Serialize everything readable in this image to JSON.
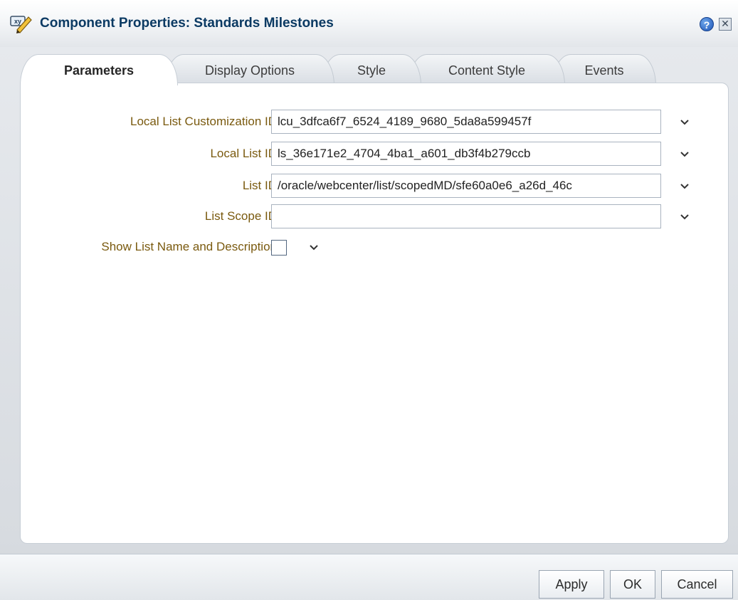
{
  "dialog": {
    "title": "Component Properties: Standards Milestones",
    "title_icon": "xy-component-icon",
    "help_icon": "help-icon",
    "help_glyph": "?",
    "close_icon": "close-icon",
    "close_glyph": "✕"
  },
  "tabs": [
    {
      "label": "Parameters",
      "active": true
    },
    {
      "label": "Display Options",
      "active": false
    },
    {
      "label": "Style",
      "active": false
    },
    {
      "label": "Content Style",
      "active": false
    },
    {
      "label": "Events",
      "active": false
    }
  ],
  "fields": [
    {
      "label": "Local List Customization ID",
      "value": "lcu_3dfca6f7_6524_4189_9680_5da8a599457f"
    },
    {
      "label": "Local List ID",
      "value": "ls_36e171e2_4704_4ba1_a601_db3f4b279ccb"
    },
    {
      "label": "List ID",
      "value": "/oracle/webcenter/list/scopedMD/sfe60a0e6_a26d_46c"
    },
    {
      "label": "List Scope ID",
      "value": ""
    }
  ],
  "checkbox_field": {
    "label": "Show List Name and Description",
    "checked": false
  },
  "buttons": {
    "apply": "Apply",
    "ok": "OK",
    "cancel": "Cancel"
  },
  "colors": {
    "title": "#0b3a63",
    "label": "#7a5a0f",
    "panel_border": "#c7ced6"
  }
}
